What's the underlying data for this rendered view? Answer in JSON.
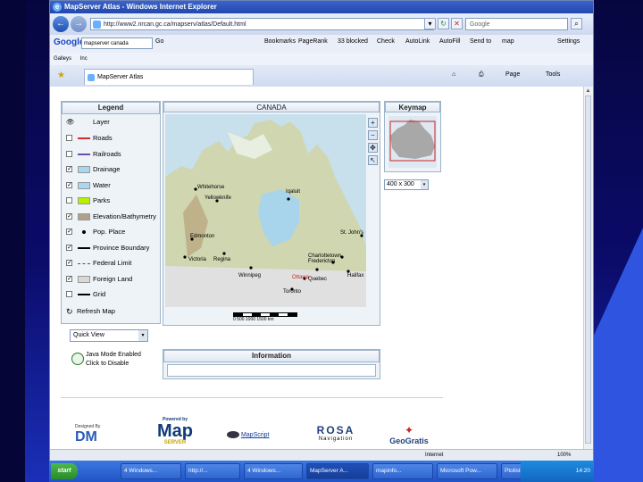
{
  "window": {
    "title": "MapServer Atlas - Windows Internet Explorer",
    "address": "http://www2.nrcan.gc.ca/mapserv/atlas/Default.html",
    "search_placeholder": "Google"
  },
  "google_toolbar": {
    "logo": "Google",
    "search_value": "mapserver canada",
    "go": "Go",
    "items": [
      "Bookmarks",
      "PageRank",
      "33 blocked",
      "Check",
      "AutoLink",
      "AutoFill",
      "Send to",
      "map",
      "Settings"
    ]
  },
  "links_bar": {
    "items": [
      "Galleys",
      "Inc"
    ]
  },
  "tabs": [
    {
      "label": "MapServer Atlas"
    }
  ],
  "command_bar": {
    "page": "Page",
    "tools": "Tools"
  },
  "legend": {
    "title": "Legend",
    "header": "Layer",
    "layers": [
      {
        "label": "Roads",
        "checked": false,
        "color": "#d22b2b",
        "symbol": "line"
      },
      {
        "label": "Railroads",
        "checked": false,
        "color": "#6a4ea8",
        "symbol": "line"
      },
      {
        "label": "Drainage",
        "checked": true,
        "color": "#a8d8f0",
        "symbol": "fill"
      },
      {
        "label": "Water",
        "checked": true,
        "color": "#a8d8f0",
        "symbol": "fill"
      },
      {
        "label": "Parks",
        "checked": false,
        "color": "#b8f000",
        "symbol": "fill"
      },
      {
        "label": "Elevation/Bathymetry",
        "checked": true,
        "color": "#b0a088",
        "symbol": "fill"
      },
      {
        "label": "Pop. Place",
        "checked": true,
        "color": "#000000",
        "symbol": "dot"
      },
      {
        "label": "Province Boundary",
        "checked": true,
        "color": "#000000",
        "symbol": "line"
      },
      {
        "label": "Federal Limit",
        "checked": true,
        "color": "#555555",
        "symbol": "dash"
      },
      {
        "label": "Foreign Land",
        "checked": true,
        "color": "#d8d8d8",
        "symbol": "fill"
      },
      {
        "label": "Grid",
        "checked": false,
        "color": "#000000",
        "symbol": "line"
      }
    ],
    "refresh": "Refresh Map"
  },
  "quick_view": "Quick View",
  "java": {
    "line1": "Java Mode Enabled",
    "line2": "Click to Disable"
  },
  "map": {
    "title": "CANADA",
    "cities": [
      "Whitehorse",
      "Yellowknife",
      "Iqaluit",
      "Edmonton",
      "Victoria",
      "Regina",
      "Winnipeg",
      "Toronto",
      "Ottawa",
      "Quebec",
      "Fredericton",
      "Charlottetown",
      "Halifax",
      "St. John's"
    ],
    "scale": "0 500 1000 1500 km"
  },
  "keymap": {
    "title": "Keymap",
    "size": "400 x 300"
  },
  "information": {
    "title": "Information"
  },
  "logos": {
    "designed_by": "Designed By",
    "powered_by": "Powered by",
    "mapserver": "Map",
    "mapserver2": "SERVER",
    "mapscript": "MapScript",
    "rosa": "ROSA",
    "navigation": "Navigation",
    "geogratis": "GeoGratis",
    "dm": "DM"
  },
  "status": {
    "zone": "Internet",
    "zoom": "100%"
  },
  "taskbar": {
    "start": "start",
    "tasks": [
      "4 Windows...",
      "http://...",
      "4 Windows...",
      "MapServer A...",
      "mapinfo...",
      "Microsoft Pow...",
      "Ptolist..."
    ],
    "clock": "14:20"
  }
}
